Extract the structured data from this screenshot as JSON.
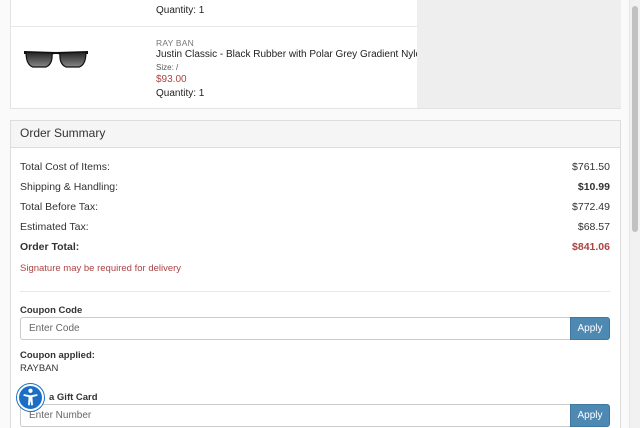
{
  "cart": {
    "prev_item_quantity": "Quantity: 1",
    "item": {
      "brand": "RAY BAN",
      "name": "Justin Classic - Black Rubber with Polar Grey Gradient Nylon",
      "size": "Size: /",
      "price": "$93.00",
      "quantity": "Quantity: 1"
    }
  },
  "summary": {
    "title": "Order Summary",
    "lines": [
      {
        "label": "Total Cost of Items:",
        "value": "$761.50"
      },
      {
        "label": "Shipping & Handling:",
        "value": "$10.99"
      },
      {
        "label": "Total Before Tax:",
        "value": "$772.49"
      },
      {
        "label": "Estimated Tax:",
        "value": "$68.57"
      },
      {
        "label": "Order Total:",
        "value": "$841.06"
      }
    ],
    "signature_note": "Signature may be required for delivery"
  },
  "coupon": {
    "label": "Coupon Code",
    "placeholder": "Enter Code",
    "apply_label": "Apply",
    "applied_label": "Coupon applied:",
    "applied_code": "RAYBAN"
  },
  "gift_card": {
    "label": "a Gift Card",
    "placeholder": "Enter Number",
    "apply_label": "Apply"
  },
  "colors": {
    "accent_red": "#a94442",
    "apply_blue": "#4e89b3",
    "accessibility_blue": "#1a6fc4"
  },
  "icons": {
    "accessibility": "accessibility-icon",
    "product": "sunglasses-image"
  }
}
